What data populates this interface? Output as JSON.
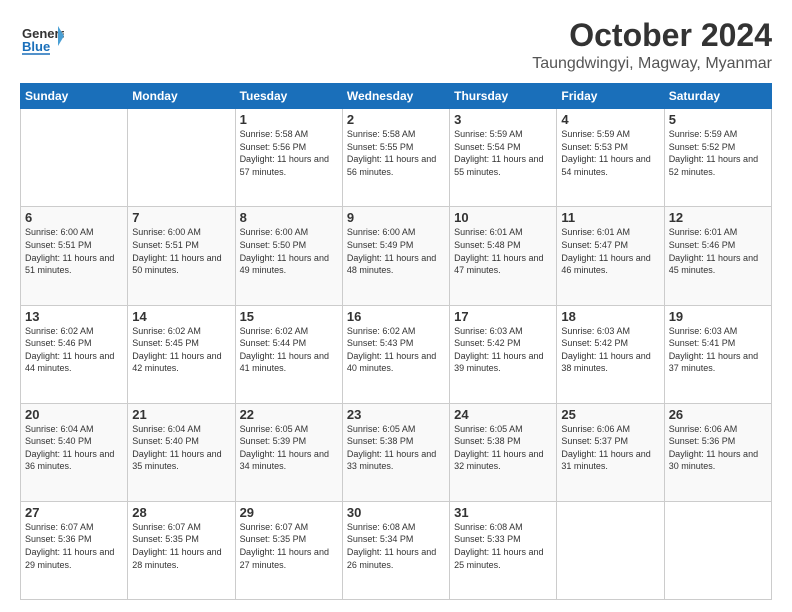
{
  "header": {
    "logo_general": "General",
    "logo_blue": "Blue",
    "title": "October 2024",
    "subtitle": "Taungdwingyi, Magway, Myanmar"
  },
  "days_of_week": [
    "Sunday",
    "Monday",
    "Tuesday",
    "Wednesday",
    "Thursday",
    "Friday",
    "Saturday"
  ],
  "weeks": [
    [
      {
        "day": "",
        "info": ""
      },
      {
        "day": "",
        "info": ""
      },
      {
        "day": "1",
        "info": "Sunrise: 5:58 AM\nSunset: 5:56 PM\nDaylight: 11 hours\nand 57 minutes."
      },
      {
        "day": "2",
        "info": "Sunrise: 5:58 AM\nSunset: 5:55 PM\nDaylight: 11 hours\nand 56 minutes."
      },
      {
        "day": "3",
        "info": "Sunrise: 5:59 AM\nSunset: 5:54 PM\nDaylight: 11 hours\nand 55 minutes."
      },
      {
        "day": "4",
        "info": "Sunrise: 5:59 AM\nSunset: 5:53 PM\nDaylight: 11 hours\nand 54 minutes."
      },
      {
        "day": "5",
        "info": "Sunrise: 5:59 AM\nSunset: 5:52 PM\nDaylight: 11 hours\nand 52 minutes."
      }
    ],
    [
      {
        "day": "6",
        "info": "Sunrise: 6:00 AM\nSunset: 5:51 PM\nDaylight: 11 hours\nand 51 minutes."
      },
      {
        "day": "7",
        "info": "Sunrise: 6:00 AM\nSunset: 5:51 PM\nDaylight: 11 hours\nand 50 minutes."
      },
      {
        "day": "8",
        "info": "Sunrise: 6:00 AM\nSunset: 5:50 PM\nDaylight: 11 hours\nand 49 minutes."
      },
      {
        "day": "9",
        "info": "Sunrise: 6:00 AM\nSunset: 5:49 PM\nDaylight: 11 hours\nand 48 minutes."
      },
      {
        "day": "10",
        "info": "Sunrise: 6:01 AM\nSunset: 5:48 PM\nDaylight: 11 hours\nand 47 minutes."
      },
      {
        "day": "11",
        "info": "Sunrise: 6:01 AM\nSunset: 5:47 PM\nDaylight: 11 hours\nand 46 minutes."
      },
      {
        "day": "12",
        "info": "Sunrise: 6:01 AM\nSunset: 5:46 PM\nDaylight: 11 hours\nand 45 minutes."
      }
    ],
    [
      {
        "day": "13",
        "info": "Sunrise: 6:02 AM\nSunset: 5:46 PM\nDaylight: 11 hours\nand 44 minutes."
      },
      {
        "day": "14",
        "info": "Sunrise: 6:02 AM\nSunset: 5:45 PM\nDaylight: 11 hours\nand 42 minutes."
      },
      {
        "day": "15",
        "info": "Sunrise: 6:02 AM\nSunset: 5:44 PM\nDaylight: 11 hours\nand 41 minutes."
      },
      {
        "day": "16",
        "info": "Sunrise: 6:02 AM\nSunset: 5:43 PM\nDaylight: 11 hours\nand 40 minutes."
      },
      {
        "day": "17",
        "info": "Sunrise: 6:03 AM\nSunset: 5:42 PM\nDaylight: 11 hours\nand 39 minutes."
      },
      {
        "day": "18",
        "info": "Sunrise: 6:03 AM\nSunset: 5:42 PM\nDaylight: 11 hours\nand 38 minutes."
      },
      {
        "day": "19",
        "info": "Sunrise: 6:03 AM\nSunset: 5:41 PM\nDaylight: 11 hours\nand 37 minutes."
      }
    ],
    [
      {
        "day": "20",
        "info": "Sunrise: 6:04 AM\nSunset: 5:40 PM\nDaylight: 11 hours\nand 36 minutes."
      },
      {
        "day": "21",
        "info": "Sunrise: 6:04 AM\nSunset: 5:40 PM\nDaylight: 11 hours\nand 35 minutes."
      },
      {
        "day": "22",
        "info": "Sunrise: 6:05 AM\nSunset: 5:39 PM\nDaylight: 11 hours\nand 34 minutes."
      },
      {
        "day": "23",
        "info": "Sunrise: 6:05 AM\nSunset: 5:38 PM\nDaylight: 11 hours\nand 33 minutes."
      },
      {
        "day": "24",
        "info": "Sunrise: 6:05 AM\nSunset: 5:38 PM\nDaylight: 11 hours\nand 32 minutes."
      },
      {
        "day": "25",
        "info": "Sunrise: 6:06 AM\nSunset: 5:37 PM\nDaylight: 11 hours\nand 31 minutes."
      },
      {
        "day": "26",
        "info": "Sunrise: 6:06 AM\nSunset: 5:36 PM\nDaylight: 11 hours\nand 30 minutes."
      }
    ],
    [
      {
        "day": "27",
        "info": "Sunrise: 6:07 AM\nSunset: 5:36 PM\nDaylight: 11 hours\nand 29 minutes."
      },
      {
        "day": "28",
        "info": "Sunrise: 6:07 AM\nSunset: 5:35 PM\nDaylight: 11 hours\nand 28 minutes."
      },
      {
        "day": "29",
        "info": "Sunrise: 6:07 AM\nSunset: 5:35 PM\nDaylight: 11 hours\nand 27 minutes."
      },
      {
        "day": "30",
        "info": "Sunrise: 6:08 AM\nSunset: 5:34 PM\nDaylight: 11 hours\nand 26 minutes."
      },
      {
        "day": "31",
        "info": "Sunrise: 6:08 AM\nSunset: 5:33 PM\nDaylight: 11 hours\nand 25 minutes."
      },
      {
        "day": "",
        "info": ""
      },
      {
        "day": "",
        "info": ""
      }
    ]
  ]
}
